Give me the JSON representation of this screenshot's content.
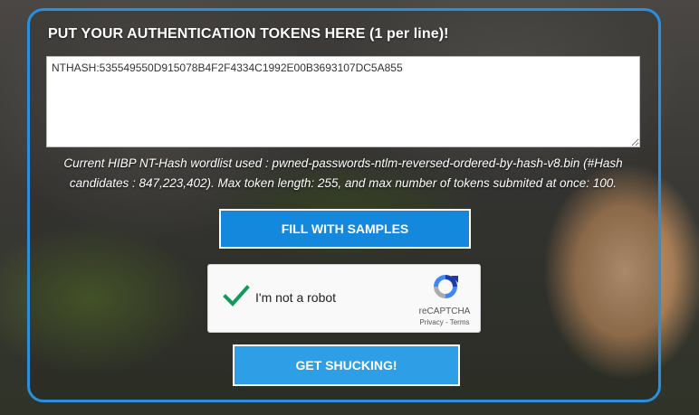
{
  "form": {
    "heading": "PUT YOUR AUTHENTICATION TOKENS HERE (1 per line)!",
    "tokens_value": "NTHASH:535549550D915078B4F2F4334C1992E00B3693107DC5A855",
    "info_text": "Current HIBP NT-Hash wordlist used : pwned-passwords-ntlm-reversed-ordered-by-hash-v8.bin (#Hash candidates : 847,223,402). Max token length: 255, and max number of tokens submited at once: 100.",
    "fill_button": "FILL WITH SAMPLES",
    "submit_button": "GET SHUCKING!"
  },
  "captcha": {
    "label": "I'm not a robot",
    "brand": "reCAPTCHA",
    "privacy": "Privacy",
    "separator": " - ",
    "terms": "Terms",
    "checked": true
  },
  "colors": {
    "accent": "#2b8fde",
    "button": "#1488dc",
    "submit_button": "#2e9ee6",
    "check": "#0e9d58"
  }
}
